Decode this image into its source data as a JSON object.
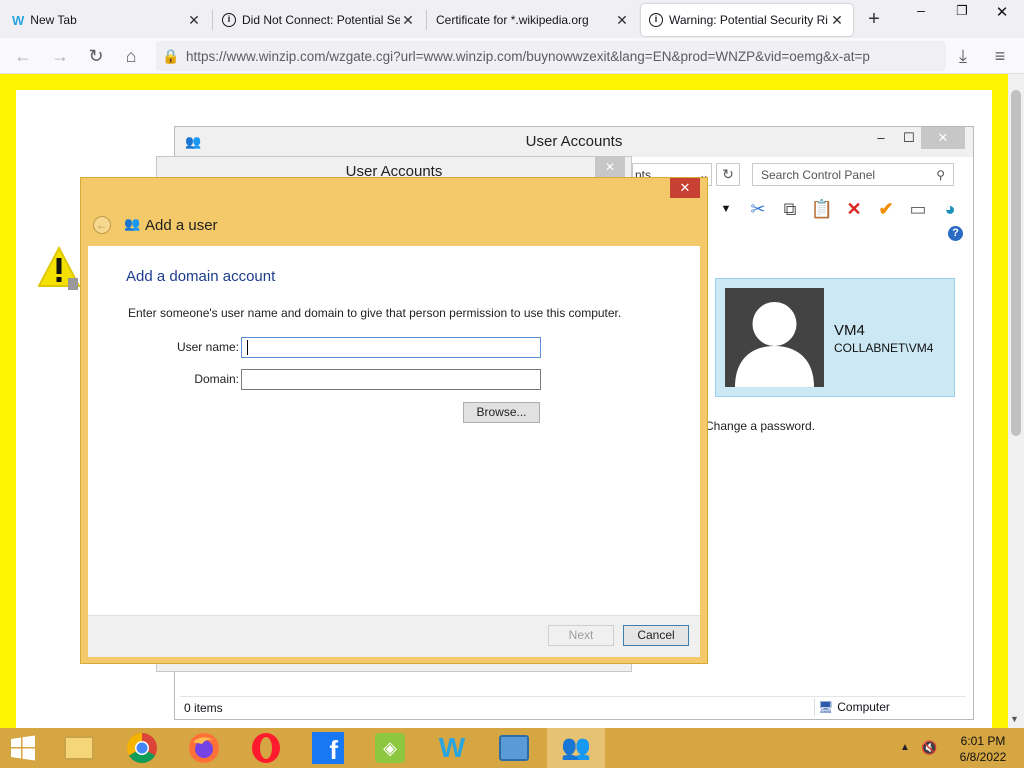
{
  "browser": {
    "tabs": [
      {
        "label": "New Tab",
        "icon": "winzip-icon"
      },
      {
        "label": "Did Not Connect: Potential Se",
        "icon": "info-icon"
      },
      {
        "label": "Certificate for *.wikipedia.org",
        "icon": ""
      },
      {
        "label": "Warning: Potential Security Ri",
        "icon": "info-icon"
      }
    ],
    "new_tab_symbol": "+",
    "url": "https://www.winzip.com/wzgate.cgi?url=www.winzip.com/buynowwzexit&lang=EN&prod=WNZP&vid=oemg&x-at=p"
  },
  "user_accounts_window": {
    "title": "User Accounts",
    "search_placeholder": "Search Control Panel",
    "dropdown_fragment": "nts",
    "user_card": {
      "name": "VM4",
      "domain_user": "COLLABNET\\VM4"
    },
    "change_password_text": "Change a password.",
    "status_items": "0 items",
    "status_location": "Computer"
  },
  "user_accounts_dialog": {
    "title": "User Accounts"
  },
  "add_user_dialog": {
    "title": "Add a user",
    "heading": "Add a domain account",
    "instructions": "Enter someone's user name and domain to give that person permission to use this computer.",
    "user_name_label": "User name:",
    "user_name_value": "",
    "domain_label": "Domain:",
    "domain_value": "",
    "browse_label": "Browse...",
    "next_label": "Next",
    "cancel_label": "Cancel"
  },
  "taskbar": {
    "apps": [
      "start-icon",
      "file-explorer-icon",
      "chrome-icon",
      "firefox-icon",
      "opera-icon",
      "facebook-icon",
      "app-icon",
      "winzip-icon",
      "control-panel-icon",
      "user-accounts-icon"
    ],
    "time": "6:01 PM",
    "date": "6/8/2022"
  },
  "colors": {
    "accent_yellow": "#fff500",
    "dialog_frame": "#f3c969",
    "taskbar": "#d5a641",
    "close_red": "#c84031"
  }
}
